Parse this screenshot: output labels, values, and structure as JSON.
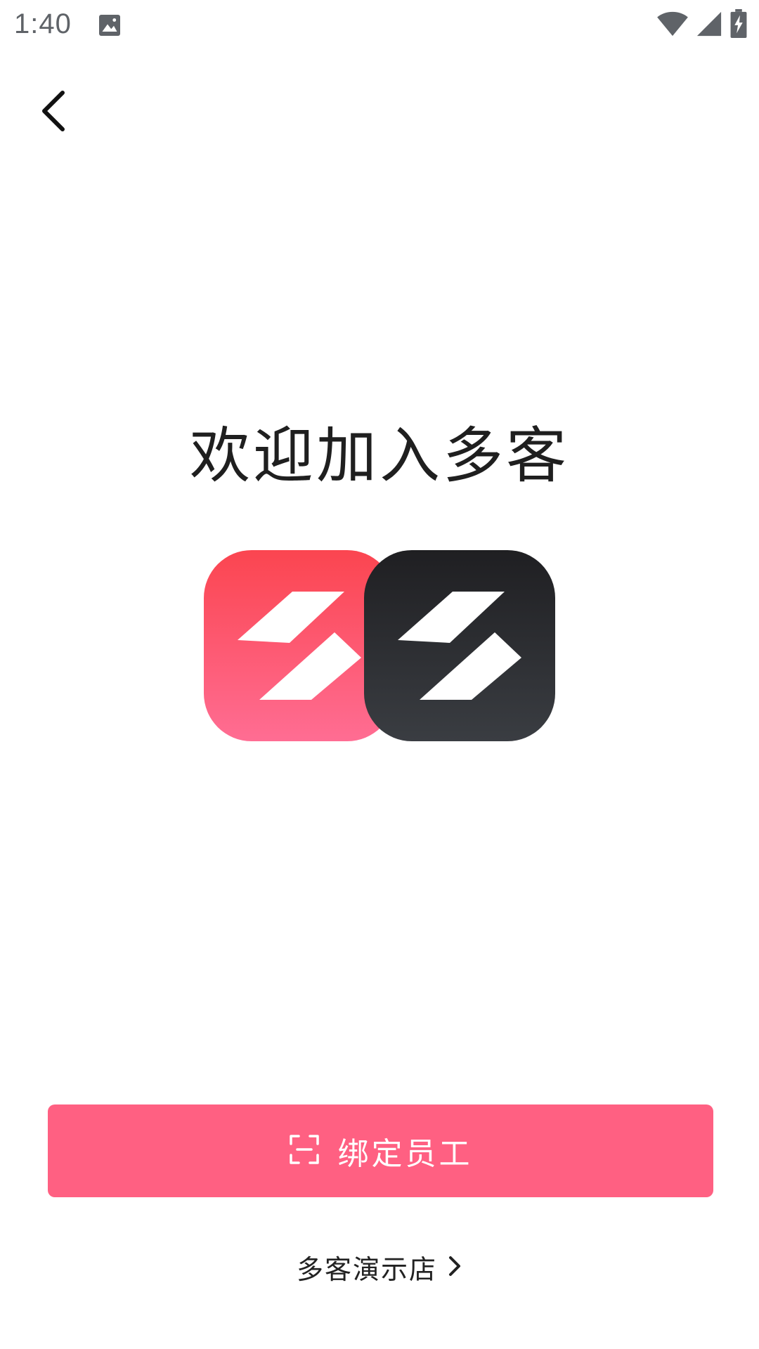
{
  "status_bar": {
    "time": "1:40",
    "icons": [
      "image-icon",
      "wifi-icon",
      "cell-signal-icon",
      "battery-charging-icon"
    ]
  },
  "header": {
    "back_icon": "chevron-left-icon"
  },
  "main": {
    "title": "欢迎加入多客",
    "logos": [
      "app-logo-red",
      "app-logo-dark"
    ]
  },
  "bind_button": {
    "label": "绑定员工",
    "icon": "scan-icon"
  },
  "store_link": {
    "label": "多客演示店",
    "icon": "chevron-right-icon"
  },
  "colors": {
    "accent": "#ff6082",
    "logo_red_top": "#fb4550",
    "logo_red_bottom": "#ff6d93",
    "logo_dark_top": "#1f1f22",
    "logo_dark_bottom": "#3a3d42"
  }
}
